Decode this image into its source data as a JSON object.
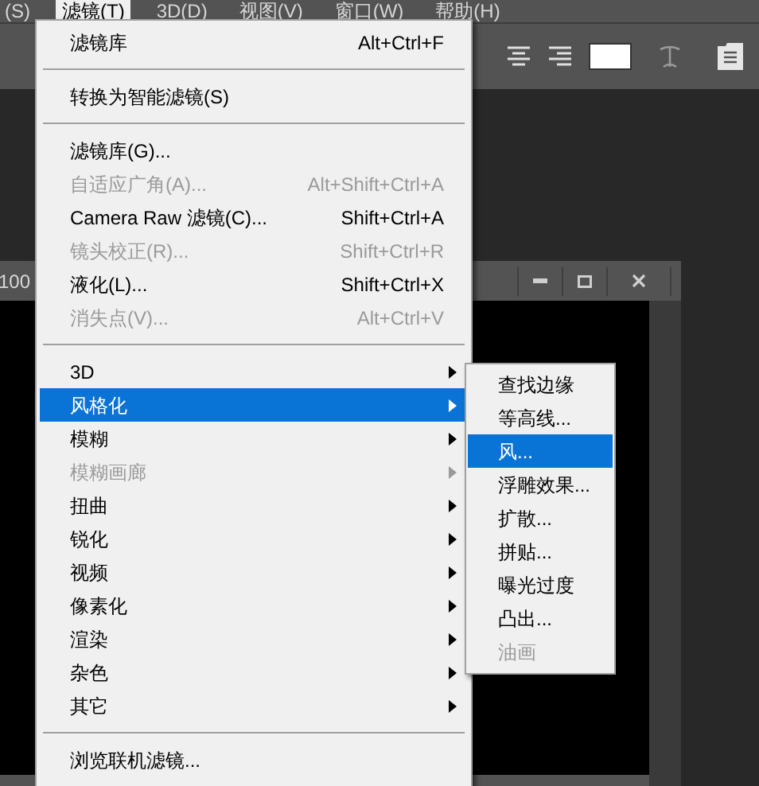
{
  "menu_bar": [
    {
      "label": "(S)",
      "selected": false
    },
    {
      "label": "滤镜(T)",
      "selected": true
    },
    {
      "label": "3D(D)",
      "selected": false
    },
    {
      "label": "视图(V)",
      "selected": false
    },
    {
      "label": "窗口(W)",
      "selected": false
    },
    {
      "label": "帮助(H)",
      "selected": false
    }
  ],
  "document": {
    "title": "100"
  },
  "filter_menu": [
    {
      "kind": "item",
      "label": "滤镜库",
      "shortcut": "Alt+Ctrl+F",
      "disabled": false,
      "selected": false
    },
    {
      "kind": "separator"
    },
    {
      "kind": "item",
      "label": "转换为智能滤镜(S)",
      "disabled": false,
      "selected": false
    },
    {
      "kind": "separator"
    },
    {
      "kind": "item",
      "label": "滤镜库(G)...",
      "disabled": false,
      "selected": false
    },
    {
      "kind": "item",
      "label": "自适应广角(A)...",
      "shortcut": "Alt+Shift+Ctrl+A",
      "disabled": true,
      "selected": false
    },
    {
      "kind": "item",
      "label": "Camera Raw 滤镜(C)...",
      "shortcut": "Shift+Ctrl+A",
      "disabled": false,
      "selected": false
    },
    {
      "kind": "item",
      "label": "镜头校正(R)...",
      "shortcut": "Shift+Ctrl+R",
      "disabled": true,
      "selected": false
    },
    {
      "kind": "item",
      "label": "液化(L)...",
      "shortcut": "Shift+Ctrl+X",
      "disabled": false,
      "selected": false
    },
    {
      "kind": "item",
      "label": "消失点(V)...",
      "shortcut": "Alt+Ctrl+V",
      "disabled": true,
      "selected": false
    },
    {
      "kind": "separator"
    },
    {
      "kind": "submenu",
      "label": "3D",
      "disabled": false,
      "selected": false
    },
    {
      "kind": "submenu",
      "label": "风格化",
      "disabled": false,
      "selected": true
    },
    {
      "kind": "submenu",
      "label": "模糊",
      "disabled": false,
      "selected": false
    },
    {
      "kind": "submenu",
      "label": "模糊画廊",
      "disabled": true,
      "selected": false
    },
    {
      "kind": "submenu",
      "label": "扭曲",
      "disabled": false,
      "selected": false
    },
    {
      "kind": "submenu",
      "label": "锐化",
      "disabled": false,
      "selected": false
    },
    {
      "kind": "submenu",
      "label": "视频",
      "disabled": false,
      "selected": false
    },
    {
      "kind": "submenu",
      "label": "像素化",
      "disabled": false,
      "selected": false
    },
    {
      "kind": "submenu",
      "label": "渲染",
      "disabled": false,
      "selected": false
    },
    {
      "kind": "submenu",
      "label": "杂色",
      "disabled": false,
      "selected": false
    },
    {
      "kind": "submenu",
      "label": "其它",
      "disabled": false,
      "selected": false
    },
    {
      "kind": "separator"
    },
    {
      "kind": "item",
      "label": "浏览联机滤镜...",
      "disabled": false,
      "selected": false
    }
  ],
  "stylize_submenu": [
    {
      "label": "查找边缘",
      "disabled": false,
      "selected": false
    },
    {
      "label": "等高线...",
      "disabled": false,
      "selected": false
    },
    {
      "label": "风...",
      "disabled": false,
      "selected": true
    },
    {
      "label": "浮雕效果...",
      "disabled": false,
      "selected": false
    },
    {
      "label": "扩散...",
      "disabled": false,
      "selected": false
    },
    {
      "label": "拼贴...",
      "disabled": false,
      "selected": false
    },
    {
      "label": "曝光过度",
      "disabled": false,
      "selected": false
    },
    {
      "label": "凸出...",
      "disabled": false,
      "selected": false
    },
    {
      "label": "油画",
      "disabled": true,
      "selected": false
    }
  ]
}
